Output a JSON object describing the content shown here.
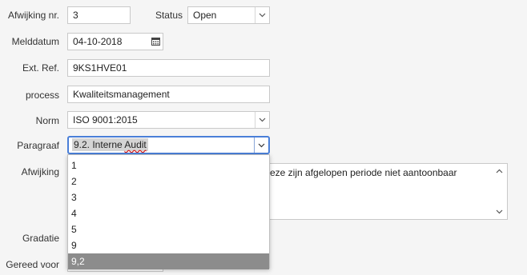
{
  "form": {
    "afwijking_nr": {
      "label": "Afwijking nr.",
      "value": "3"
    },
    "status": {
      "label": "Status",
      "value": "Open"
    },
    "melddatum": {
      "label": "Melddatum",
      "value": "04-10-2018"
    },
    "ext_ref": {
      "label": "Ext. Ref.",
      "value": "9KS1HVE01"
    },
    "process": {
      "label": "process",
      "value": "Kwaliteitsmanagement"
    },
    "norm": {
      "label": "Norm",
      "value": "ISO 9001:2015"
    },
    "paragraaf": {
      "label": "Paragraaf",
      "value_prefix": "9.2. Interne ",
      "value_underlined": "Audit"
    },
    "afwijking": {
      "label": "Afwijking",
      "value": "eze zijn afgelopen periode niet aantoonbaar"
    },
    "gradatie": {
      "label": "Gradatie"
    },
    "gereed_voor": {
      "label": "Gereed voor"
    }
  },
  "dropdown": {
    "options": [
      "1",
      "2",
      "3",
      "4",
      "5",
      "9",
      "9,2"
    ],
    "selected_index": 6
  },
  "colors": {
    "selected_option_bg": "#8c8c8c",
    "focus_border": "#4a7fd8"
  }
}
